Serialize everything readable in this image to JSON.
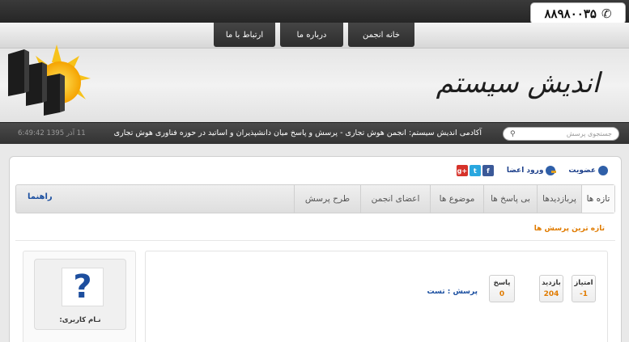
{
  "topbar": {
    "phone": "۸۸۹۸۰۰۳۵",
    "phone_icon": "phone-icon"
  },
  "menu": {
    "items": [
      {
        "label": "خانه انجمن"
      },
      {
        "label": "درباره ما"
      },
      {
        "label": "ارتباط با ما"
      }
    ]
  },
  "header": {
    "brand": "اندیش سیستم",
    "logo_icon": "sun-buildings-logo"
  },
  "strip": {
    "search_placeholder": "جستجوی پرسش",
    "tagline": "آکادمی اندیش سیستم: انجمن هوش تجاری - پرسش و پاسخ میان دانشپذیران و اساتید در حوزه فناوری هوش تجاری",
    "datetime": "11 آذر 1395 6:49:42"
  },
  "userlinks": {
    "register": "عضویت",
    "login": "ورود اعضا"
  },
  "social": {
    "facebook": "f",
    "twitter": "t",
    "googleplus": "g+"
  },
  "tabs": [
    {
      "label": "تازه ها"
    },
    {
      "label": "پربازدیدها"
    },
    {
      "label": "بی پاسخ ها"
    },
    {
      "label": "موضوع ها"
    },
    {
      "label": "اعضای انجمن"
    },
    {
      "label": "طرح پرسش"
    }
  ],
  "guide": "راهنما",
  "section_title": "تازه ترین پرسش ها",
  "question": {
    "title": "پرسش : تست",
    "stats": [
      {
        "label": "امتیاز",
        "value": "-1"
      },
      {
        "label": "بازدید",
        "value": "204"
      },
      {
        "label": "پاسخ",
        "value": "0"
      }
    ]
  },
  "sidebar": {
    "username_label": "نـام کاربری:"
  }
}
